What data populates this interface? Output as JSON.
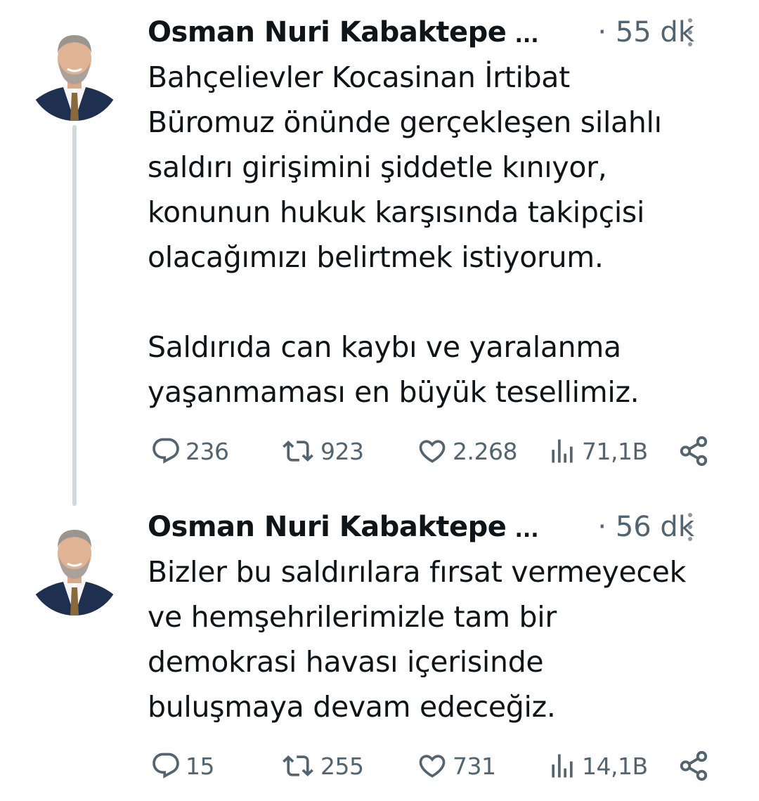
{
  "tweets": [
    {
      "author_name": "Osman Nuri Kabaktepe",
      "truncation": "...",
      "time": "· 55 dk",
      "text": "Bahçelievler Kocasinan İrtibat\nBüromuz önünde gerçekleşen silahlı\nsaldırı girişimini şiddetle kınıyor,\nkonunun hukuk karşısında takipçisi\nolacağımızı belirtmek istiyorum.\n\nSaldırıda can kaybı ve yaralanma\nyaşanmaması en büyük tesellimiz.",
      "replies": "236",
      "retweets": "923",
      "likes": "2.268",
      "views": "71,1B"
    },
    {
      "author_name": "Osman Nuri Kabaktepe",
      "truncation": "...",
      "time": "· 56 dk",
      "text": "Bizler bu saldırılara fırsat vermeyecek\nve hemşehrilerimizle tam bir\ndemokrasi havası içerisinde\nbuluşmaya devam edeceğiz.",
      "replies": "15",
      "retweets": "255",
      "likes": "731",
      "views": "14,1B"
    }
  ],
  "icons": {
    "reply": "reply-icon",
    "retweet": "retweet-icon",
    "like": "like-icon",
    "views": "views-icon",
    "share": "share-icon",
    "more": "more-icon"
  },
  "colors": {
    "text": "#0f1419",
    "secondary": "#536471",
    "thread_line": "#cfd9de"
  }
}
